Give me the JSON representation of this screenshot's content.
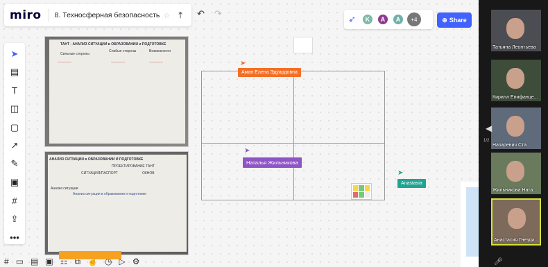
{
  "app": {
    "logo": "miro",
    "board_title": "8. Техносферная безопасность"
  },
  "collab": {
    "avatars": [
      {
        "initial": "K",
        "color": "#7fb8a8"
      },
      {
        "initial": "A",
        "color": "#8e3a8e"
      },
      {
        "initial": "A",
        "color": "#6fb0a8"
      }
    ],
    "more_label": "+4"
  },
  "share_label": "Share",
  "cursors": [
    {
      "name": "Аман Елена Эдуардовна",
      "color": "#f36f26"
    },
    {
      "name": "Наталья Жильникова",
      "color": "#8e55c7"
    },
    {
      "name": "Anastasia",
      "color": "#20a491"
    }
  ],
  "photo1": {
    "heading": "ТАНТ - АНАЛИЗ СИТУАЦИИ в ОБРАЗОВАНИИ и ПОДГОТОВКЕ",
    "col1": "Сильные стороны",
    "col2": "Слабые стороны",
    "col3": "Возможности"
  },
  "photo2": {
    "heading": "АНАЛИЗ СИТУАЦИИ в ОБРАЗОВАНИИ И ПОДГОТОВКЕ",
    "sub": "ПРОЕКТИРОВАНИЕ ТАНТ",
    "col1": "СИТУАЦИЯ/ПАСПОРТ",
    "col2": "ОКНОВ",
    "row1": "Анализ ситуации",
    "cell1": "Анализ ситуации в образовании и подготовке"
  },
  "participants": [
    {
      "name": "Татьяна Леонтьева"
    },
    {
      "name": "Кирилл Епифанце..."
    },
    {
      "name": "Назаревич Ста..."
    },
    {
      "name": "Жильникова Ната..."
    },
    {
      "name": "Анастасия Гнезди..."
    }
  ],
  "page_indicator": "1/2"
}
